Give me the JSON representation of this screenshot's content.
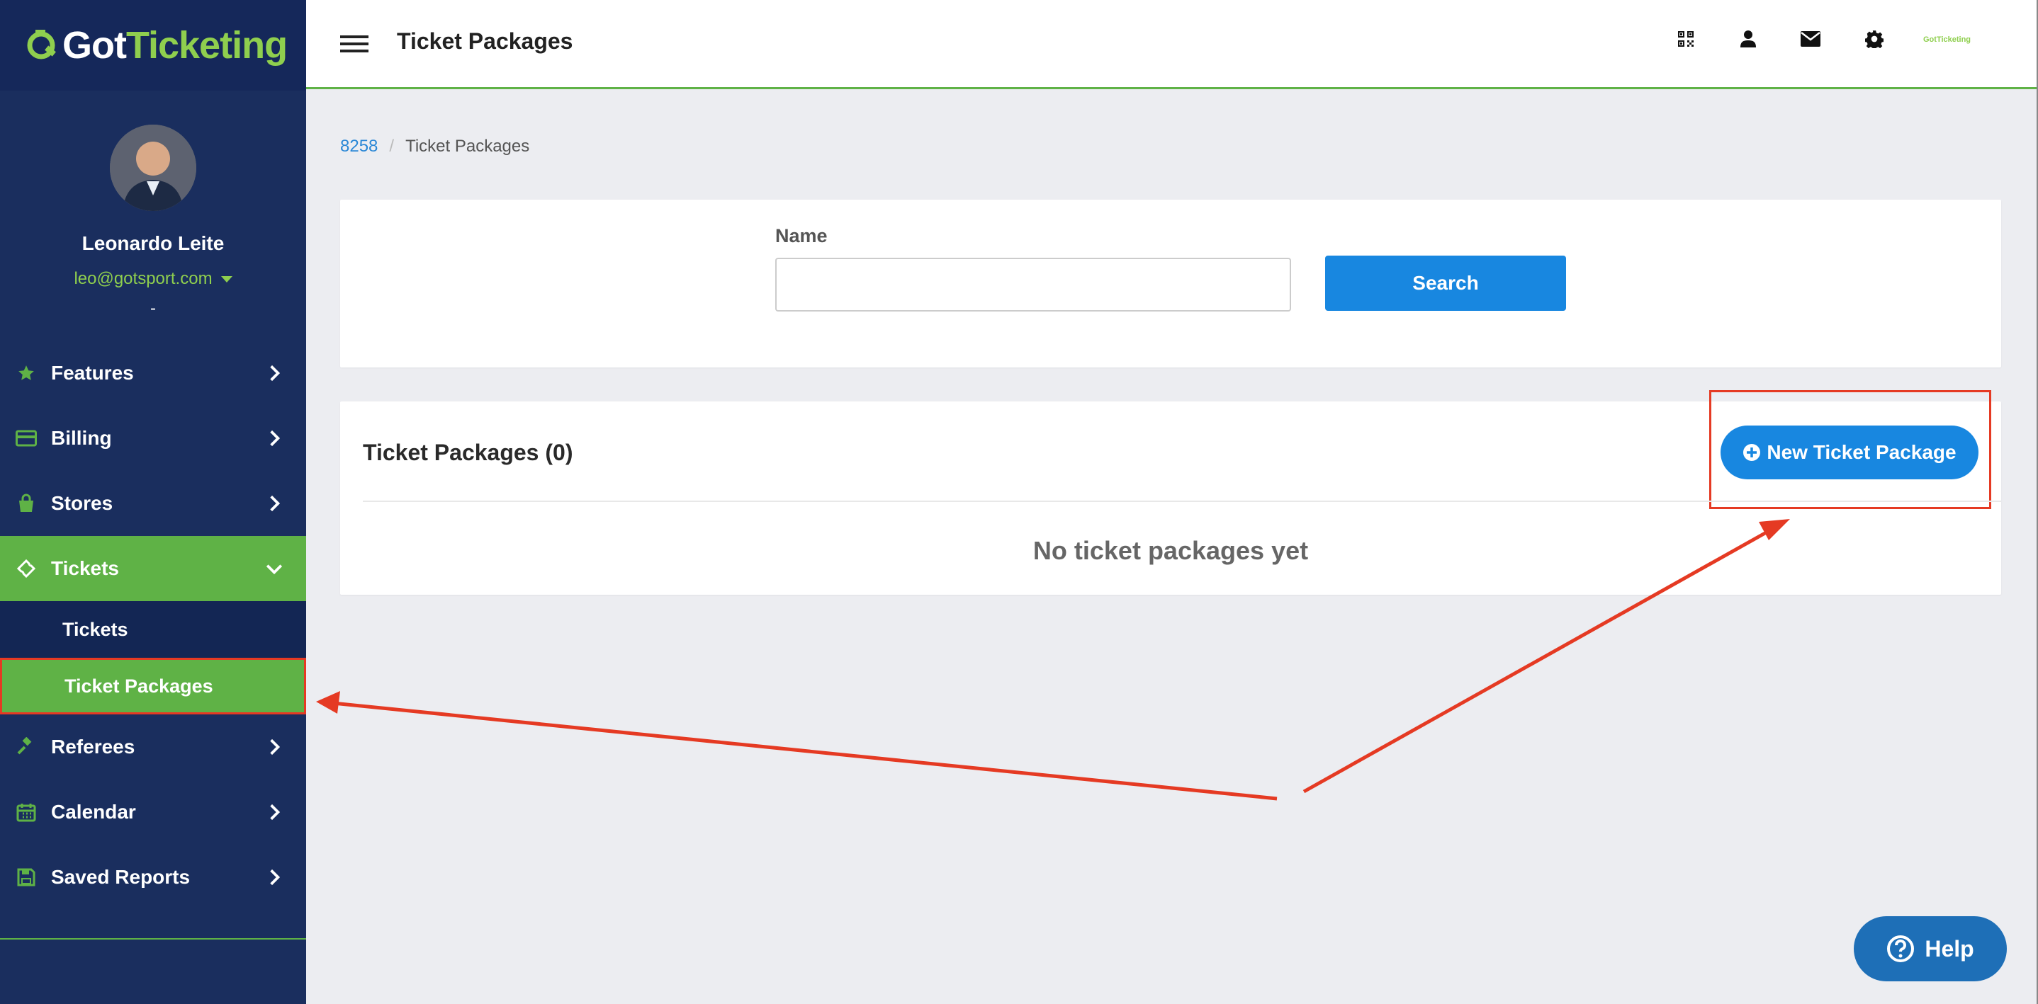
{
  "brand": {
    "logo_got": "Got",
    "logo_ticketing": "Ticketing",
    "mini_logo": "GotTicketing"
  },
  "profile": {
    "name": "Leonardo Leite",
    "email": "leo@gotsport.com",
    "extra": "-"
  },
  "nav": {
    "features": "Features",
    "billing": "Billing",
    "stores": "Stores",
    "tickets": "Tickets",
    "tickets_sub": "Tickets",
    "ticket_packages_sub": "Ticket Packages",
    "referees": "Referees",
    "calendar": "Calendar",
    "saved_reports": "Saved Reports"
  },
  "header": {
    "title": "Ticket Packages"
  },
  "breadcrumb": {
    "link": "8258",
    "separator": "/",
    "current": "Ticket Packages"
  },
  "search": {
    "label": "Name",
    "value": "",
    "button": "Search"
  },
  "list": {
    "title": "Ticket Packages (0)",
    "new_button": "New Ticket Package",
    "empty": "No ticket packages yet"
  },
  "help": {
    "label": "Help"
  },
  "colors": {
    "sidebar": "#1a2e5e",
    "accent_green": "#5fb246",
    "primary_blue": "#1887e0",
    "annotation_red": "#e53a23"
  }
}
